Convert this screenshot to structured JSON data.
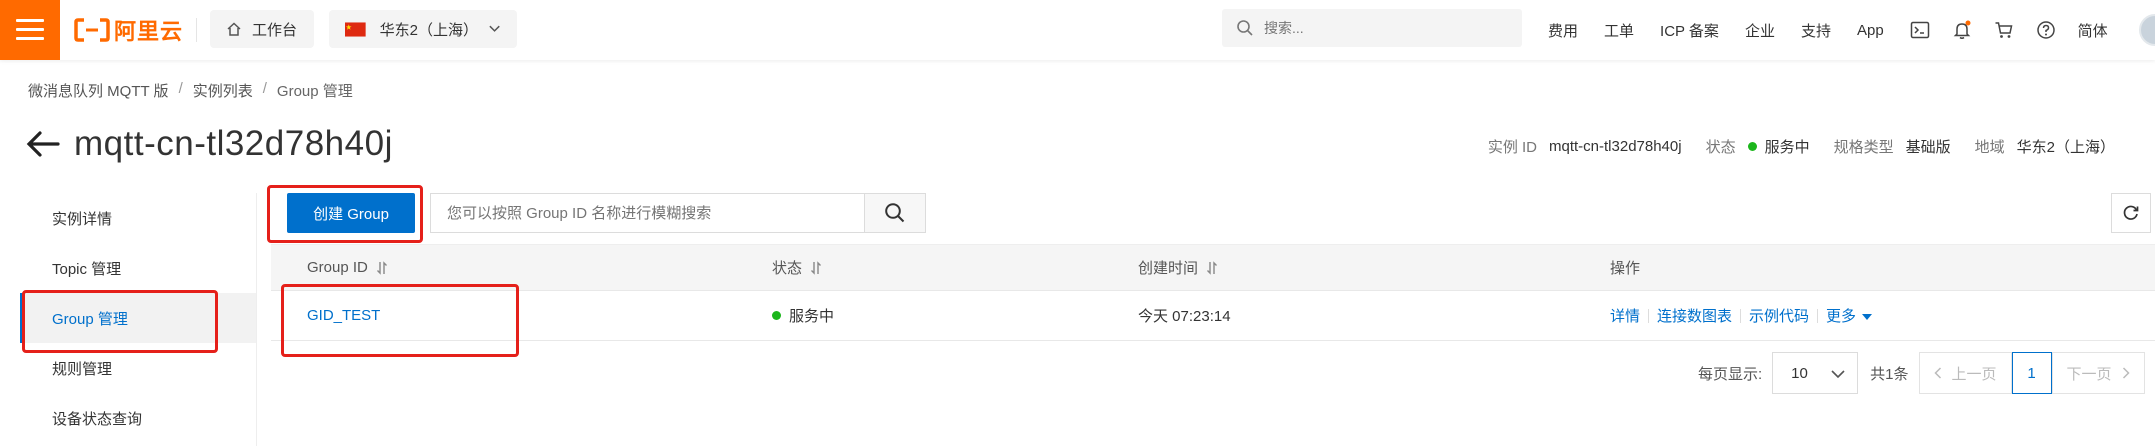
{
  "topbar": {
    "logo_text": "阿里云",
    "workbench_label": "工作台",
    "region_label": "华东2（上海）",
    "search_placeholder": "搜索...",
    "links": [
      "费用",
      "工单",
      "ICP 备案",
      "企业",
      "支持",
      "App"
    ],
    "lang_label": "简体",
    "brand_color": "#ff6a00"
  },
  "breadcrumb": {
    "items": [
      "微消息队列 MQTT 版",
      "实例列表",
      "Group 管理"
    ]
  },
  "header": {
    "title": "mqtt-cn-tl32d78h40j",
    "instance_id_label": "实例 ID",
    "instance_id_value": "mqtt-cn-tl32d78h40j",
    "status_label": "状态",
    "status_value": "服务中",
    "spec_label": "规格类型",
    "spec_value": "基础版",
    "region_label": "地域",
    "region_value": "华东2（上海）"
  },
  "sidebar": {
    "items": [
      {
        "label": "实例详情"
      },
      {
        "label": "Topic 管理"
      },
      {
        "label": "Group 管理"
      },
      {
        "label": "规则管理"
      },
      {
        "label": "设备状态查询"
      }
    ],
    "active_index": 2
  },
  "toolbar": {
    "create_label": "创建 Group",
    "search_placeholder": "您可以按照 Group ID 名称进行模糊搜索"
  },
  "table": {
    "columns": [
      "Group ID",
      "状态",
      "创建时间",
      "操作"
    ],
    "rows": [
      {
        "group_id": "GID_TEST",
        "status": "服务中",
        "created": "今天 07:23:14",
        "actions": [
          "详情",
          "连接数图表",
          "示例代码",
          "更多"
        ]
      }
    ]
  },
  "pagination": {
    "per_page_label": "每页显示:",
    "per_page_value": "10",
    "total_label": "共1条",
    "prev_label": "上一页",
    "current_page": "1",
    "next_label": "下一页"
  },
  "colors": {
    "accent": "#0070cc",
    "status_green": "#1cb61c",
    "highlight_red": "#e5201a"
  }
}
